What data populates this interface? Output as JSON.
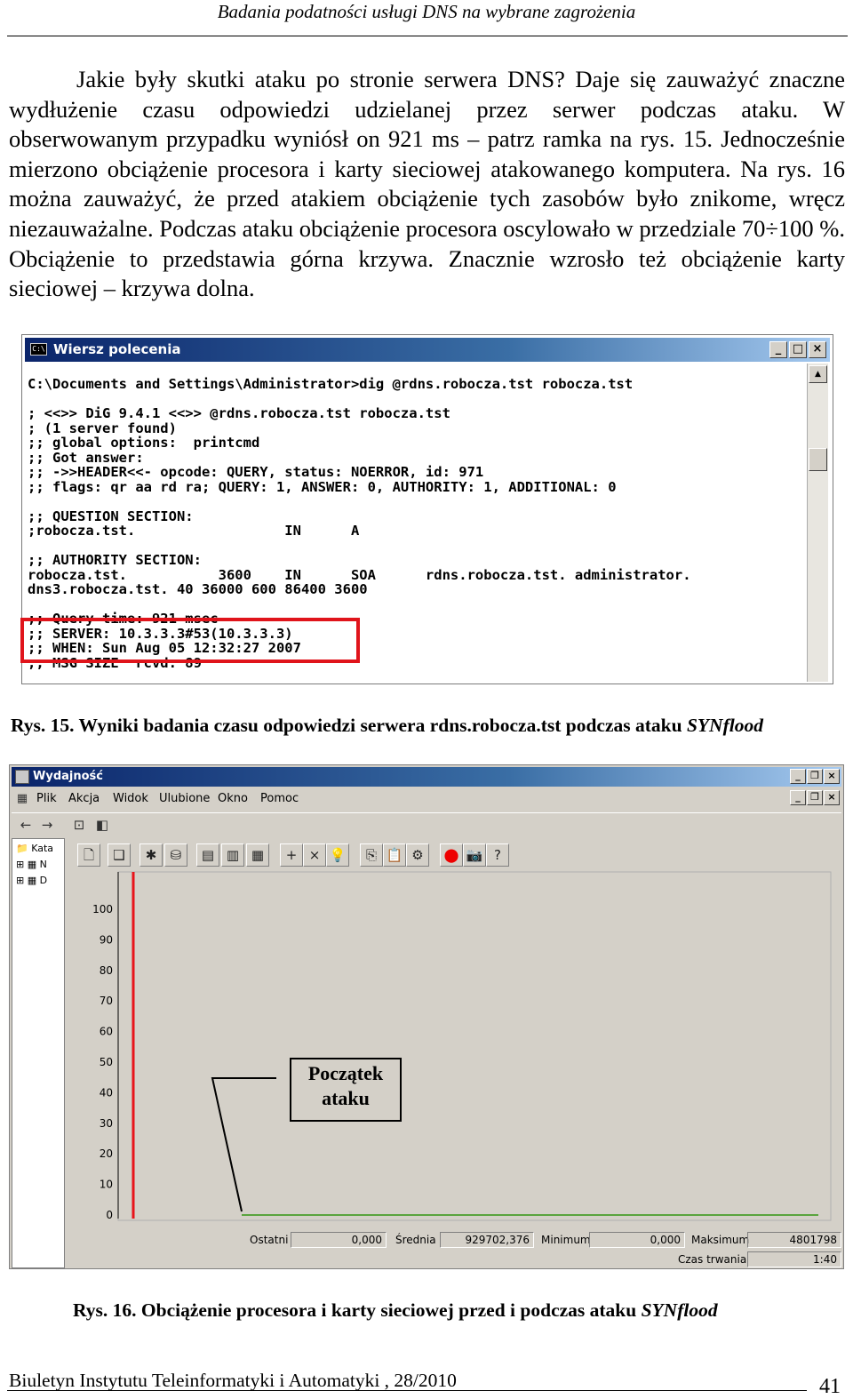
{
  "header": {
    "running_title": "Badania podatności usługi DNS na wybrane zagrożenia"
  },
  "body": {
    "paragraph": "Jakie były skutki ataku po stronie serwera DNS? Daje się zauważyć znaczne wydłużenie czasu odpowiedzi udzielanej przez serwer podczas ataku. W obserwowanym przypadku wyniósł on 921 ms – patrz ramka na rys. 15. Jednocześnie mierzono obciążenie procesora i karty sieciowej atakowanego komputera. Na rys. 16 można zauważyć, że przed atakiem obciążenie tych zasobów było znikome, wręcz niezauważalne. Podczas ataku obciążenie procesora oscylowało w przedziale 70÷100 %. Obciążenie to przedstawia górna krzywa. Znacznie wzrosło też obciążenie karty sieciowej – krzywa dolna."
  },
  "figure15": {
    "window_title": "Wiersz polecenia",
    "icon_text": "C:\\",
    "window_buttons": [
      "_",
      "□",
      "×"
    ],
    "console_lines": [
      "C:\\Documents and Settings\\Administrator>dig @rdns.robocza.tst robocza.tst",
      "",
      "; <<>> DiG 9.4.1 <<>> @rdns.robocza.tst robocza.tst",
      "; (1 server found)",
      ";; global options:  printcmd",
      ";; Got answer:",
      ";; ->>HEADER<<- opcode: QUERY, status: NOERROR, id: 971",
      ";; flags: qr aa rd ra; QUERY: 1, ANSWER: 0, AUTHORITY: 1, ADDITIONAL: 0",
      "",
      ";; QUESTION SECTION:",
      ";robocza.tst.                  IN      A",
      "",
      ";; AUTHORITY SECTION:",
      "robocza.tst.           3600    IN      SOA      rdns.robocza.tst. administrator.",
      "dns3.robocza.tst. 40 36000 600 86400 3600",
      "",
      ";; Query time: 921 msec",
      ";; SERVER: 10.3.3.3#53(10.3.3.3)",
      ";; WHEN: Sun Aug 05 12:32:27 2007",
      ";; MSG SIZE  rcvd: 89"
    ],
    "caption_prefix": "Rys. 15. Wyniki badania czasu odpowiedzi serwera rdns.robocza.tst podczas ataku ",
    "caption_italic": "SYNflood"
  },
  "figure16": {
    "window_title": "Wydajność",
    "menu": [
      "Plik",
      "Akcja",
      "Widok",
      "Ulubione",
      "Okno",
      "Pomoc"
    ],
    "tree_items": [
      "Kata",
      "N",
      "D"
    ],
    "annotation": [
      "Początek",
      "ataku"
    ],
    "stats": {
      "last_label": "Ostatni",
      "last_value": "0,000",
      "avg_label": "Średnia",
      "avg_value": "929702,376",
      "min_label": "Minimum",
      "min_value": "0,000",
      "max_label": "Maksimum",
      "max_value": "4801798",
      "duration_label": "Czas trwania",
      "duration_value": "1:40"
    },
    "caption_prefix": "Rys. 16. Obciążenie procesora i karty sieciowej przed i podczas ataku ",
    "caption_italic": "SYNflood"
  },
  "chart_data": {
    "type": "line",
    "title": "",
    "xlabel": "",
    "ylabel": "",
    "ylim": [
      0,
      100
    ],
    "yticks": [
      "100",
      "90",
      "80",
      "70",
      "60",
      "50",
      "40",
      "30",
      "20",
      "10",
      "0"
    ],
    "grid": false,
    "legend": "none",
    "x_count": 100,
    "series": [
      {
        "color": "#e8141b",
        "values": [
          0,
          0,
          0,
          0,
          0,
          0,
          0,
          0,
          0,
          0,
          0,
          0,
          0,
          0,
          0,
          0,
          0,
          0,
          0,
          0,
          0,
          0,
          0,
          0,
          0,
          0,
          0,
          0,
          0,
          0,
          0,
          0,
          0,
          0,
          0,
          0,
          0,
          0,
          0,
          0,
          0,
          0,
          0,
          0,
          0,
          0,
          0,
          0,
          0,
          0,
          0,
          0,
          0,
          0,
          0,
          0,
          0,
          0,
          0,
          0,
          0,
          0,
          0,
          0,
          0,
          0,
          0,
          0,
          0,
          0,
          0,
          0,
          0,
          0,
          0,
          0,
          0,
          0,
          0,
          0,
          0,
          0,
          0,
          0,
          0,
          0,
          0,
          0,
          0,
          0,
          0,
          0,
          0,
          0,
          0,
          0,
          0,
          0,
          0,
          0
        ]
      },
      {
        "color": "#2db52d",
        "values": [
          0,
          0,
          0,
          0,
          0,
          0,
          0,
          0,
          0,
          0,
          0,
          0,
          0,
          0,
          0,
          0,
          0,
          0,
          0,
          0,
          0,
          0,
          0,
          0,
          0,
          0,
          0,
          0,
          0,
          0,
          0,
          0,
          0,
          0,
          0,
          0,
          0,
          0,
          0,
          0,
          0,
          0,
          0,
          0,
          0,
          0,
          0,
          0,
          0,
          0,
          0,
          0,
          0,
          0,
          0,
          0,
          0,
          0,
          0,
          0,
          0,
          0,
          0,
          0,
          0,
          0,
          0,
          0,
          0,
          0,
          0,
          0,
          0,
          0,
          0,
          0,
          0,
          0,
          0,
          0,
          0,
          0,
          0,
          0,
          0,
          0,
          0,
          0,
          0,
          0,
          0,
          0,
          0,
          0,
          0,
          0,
          0,
          0,
          0,
          0
        ]
      }
    ]
  }
}
